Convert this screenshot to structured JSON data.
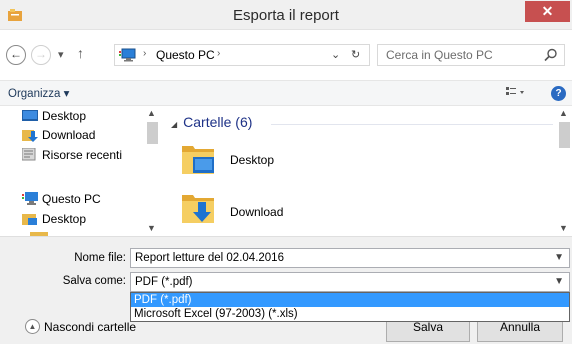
{
  "window": {
    "title": "Esporta il report",
    "close_glyph": "✕"
  },
  "nav": {
    "back_glyph": "←",
    "forward_glyph": "→",
    "history_glyph": "▾",
    "up_glyph": "↑",
    "address_segments": [
      "Questo PC"
    ],
    "address_sep": "›",
    "address_dropdown_glyph": "⌄",
    "refresh_glyph": "↻",
    "search_placeholder": "Cerca in Questo PC"
  },
  "toolbar": {
    "organize_label": "Organizza ▾",
    "help_glyph": "?"
  },
  "sidebar": {
    "items": [
      {
        "label": "Desktop",
        "icon": "desktop-icon"
      },
      {
        "label": "Download",
        "icon": "download-folder-icon"
      },
      {
        "label": "Risorse recenti",
        "icon": "recent-places-icon"
      },
      {
        "label": "Questo PC",
        "icon": "computer-icon"
      },
      {
        "label": "Desktop",
        "icon": "desktop-folder-icon"
      }
    ]
  },
  "content": {
    "group_label": "Cartelle (6)",
    "group_chevron": "◢",
    "folders": [
      {
        "label": "Desktop",
        "icon": "desktop-folder-icon"
      },
      {
        "label": "Download",
        "icon": "download-folder-icon"
      }
    ]
  },
  "form": {
    "filename_label": "Nome file:",
    "filename_value": "Report letture del 02.04.2016",
    "savetype_label": "Salva come:",
    "savetype_value": "PDF (*.pdf)",
    "options": [
      "PDF (*.pdf)",
      "Microsoft Excel (97-2003) (*.xls)"
    ],
    "selected_index": 0
  },
  "buttons": {
    "save": "Salva",
    "cancel": "Annulla",
    "hide_folders": "Nascondi cartelle"
  },
  "colors": {
    "selection": "#3399ff",
    "close": "#c75050",
    "link_blue": "#1e3287"
  }
}
